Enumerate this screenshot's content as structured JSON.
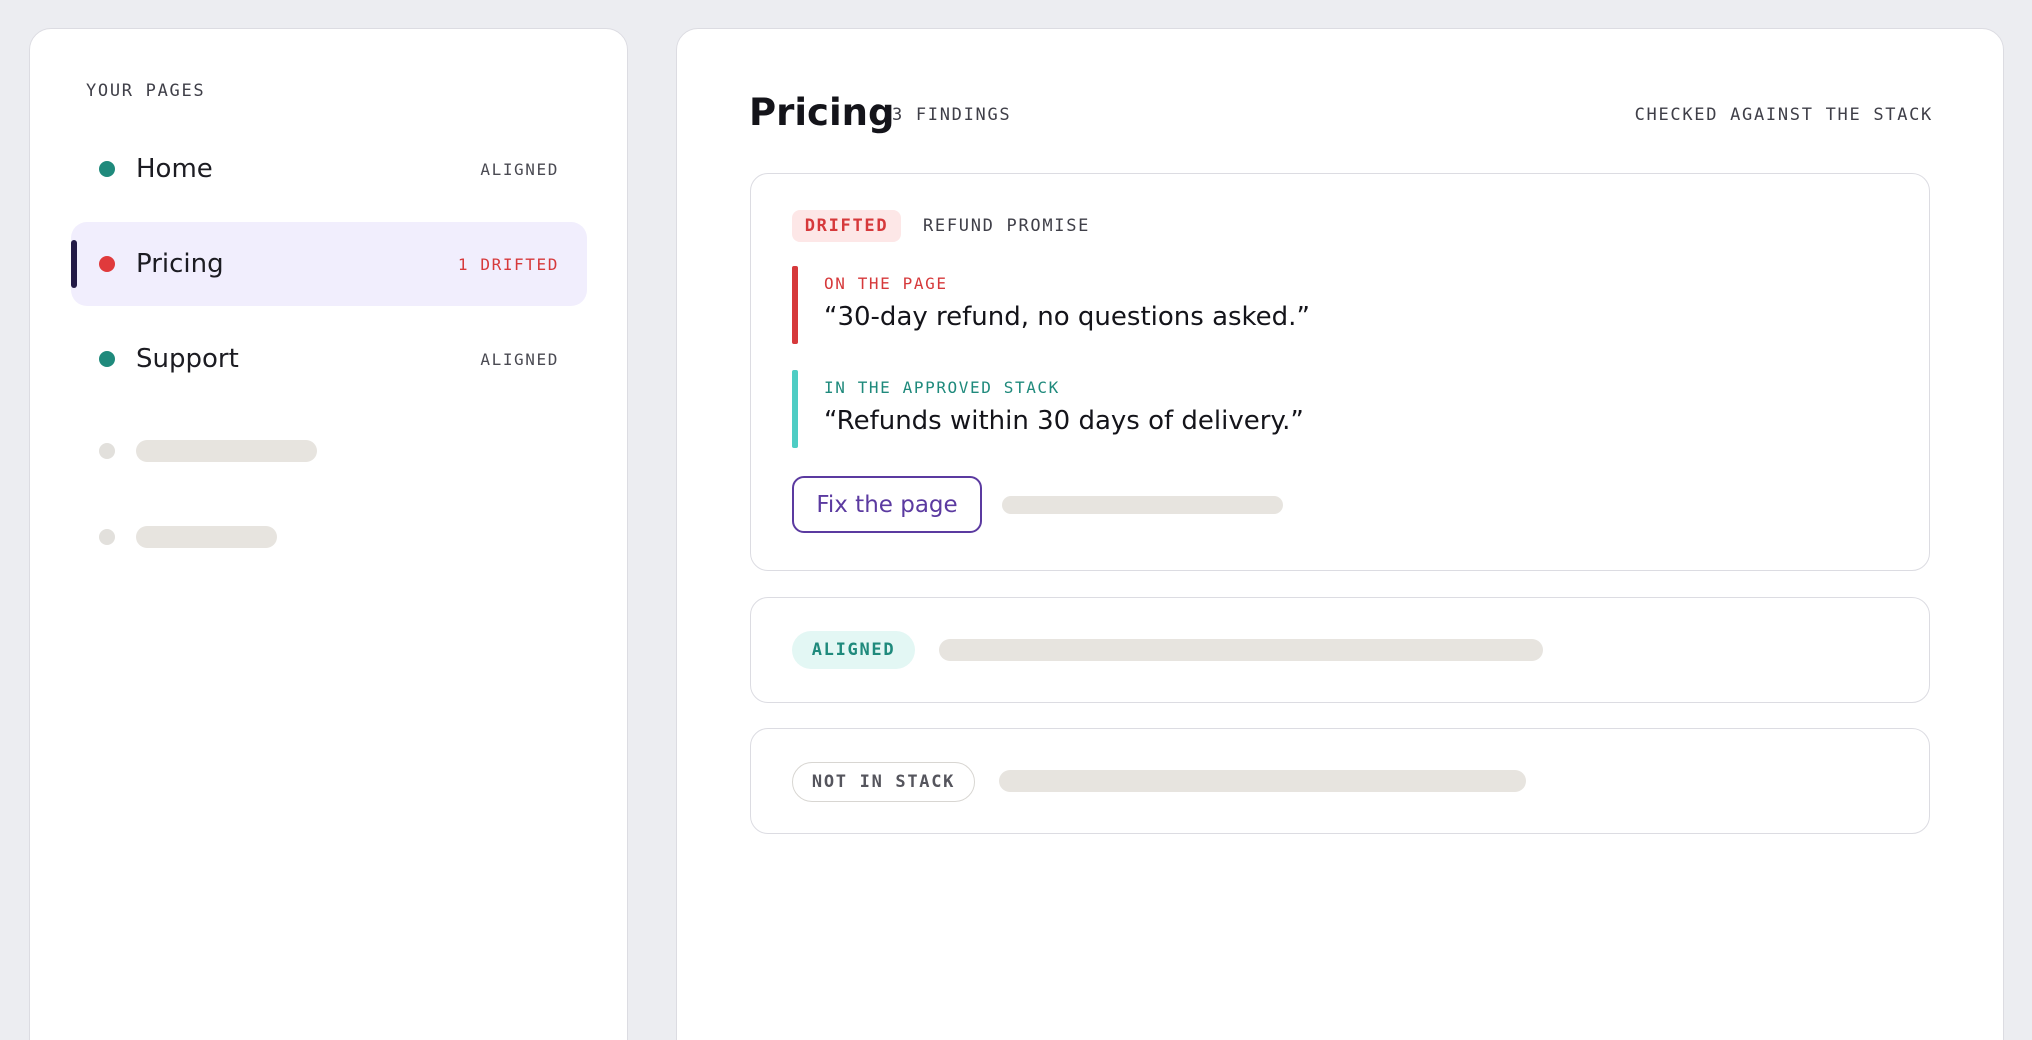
{
  "sidebar": {
    "heading": "YOUR PAGES",
    "items": [
      {
        "label": "Home",
        "status": "ALIGNED",
        "state": "aligned",
        "dot_color": "#1f8a7c"
      },
      {
        "label": "Pricing",
        "status": "1 DRIFTED",
        "state": "drifted",
        "dot_color": "#e03a3c",
        "active": true
      },
      {
        "label": "Support",
        "status": "ALIGNED",
        "state": "aligned",
        "dot_color": "#1f8a7c"
      }
    ]
  },
  "main": {
    "title": "Pricing",
    "findings_count": "3 FINDINGS",
    "checked_label": "CHECKED AGAINST THE STACK",
    "findings": [
      {
        "badge": "DRIFTED",
        "topic": "REFUND PROMISE",
        "on_page_label": "ON THE PAGE",
        "on_page_text": "“30-day refund, no questions asked.”",
        "stack_label": "IN THE APPROVED STACK",
        "stack_text": "“Refunds within 30 days of delivery.”",
        "action_label": "Fix the page"
      },
      {
        "badge": "ALIGNED"
      },
      {
        "badge": "NOT IN STACK"
      }
    ]
  },
  "colors": {
    "accent": "#5b3aa0",
    "drifted": "#d6393b",
    "aligned": "#1f8a7c",
    "stack_stripe": "#4ecdc4"
  }
}
